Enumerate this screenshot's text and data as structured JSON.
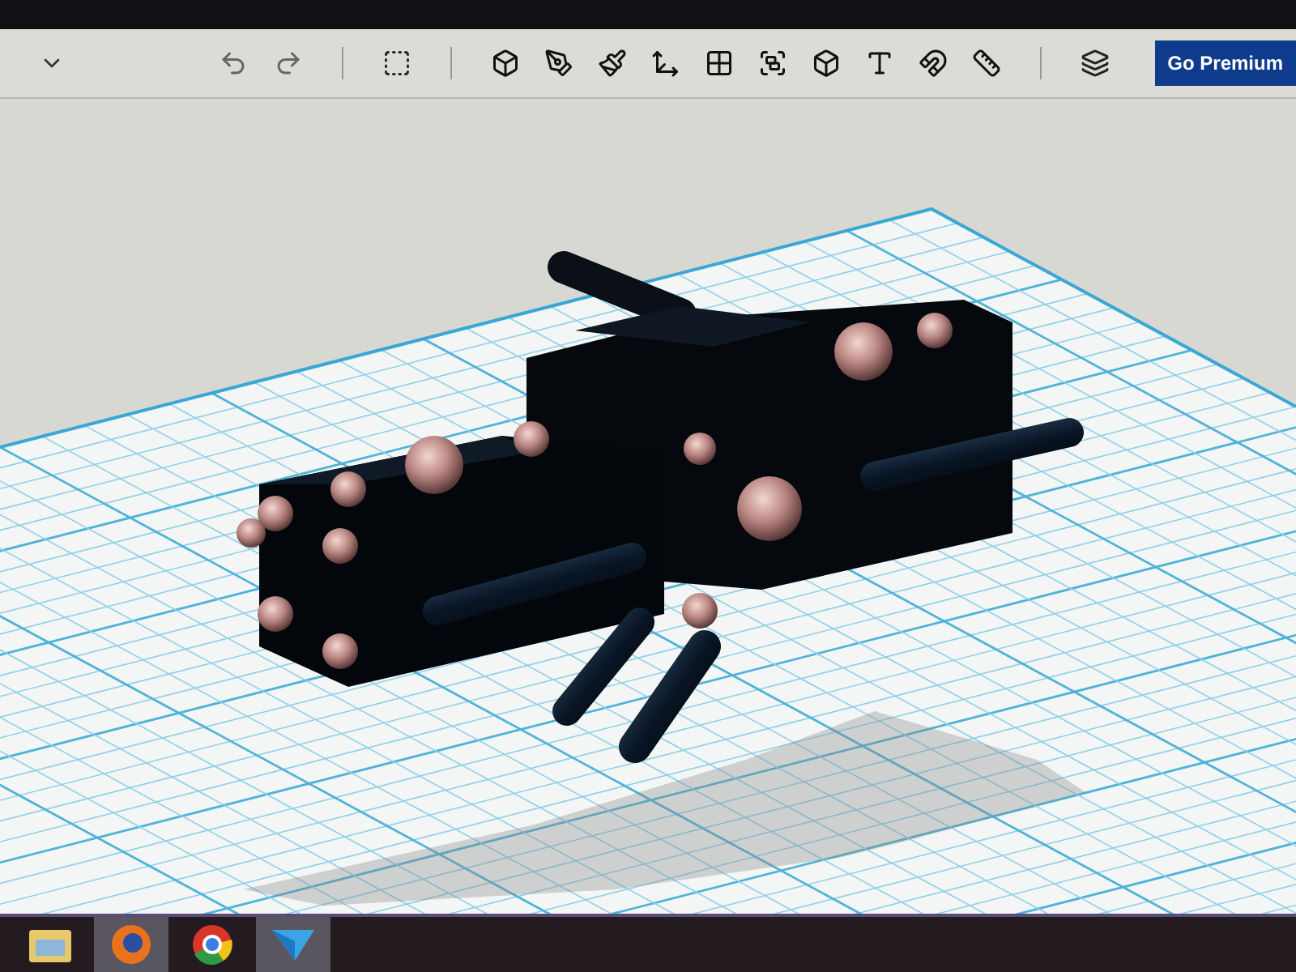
{
  "toolbar": {
    "premium_button": "Go Premium"
  },
  "taskbar": [
    {
      "kind": "folder",
      "selected": false
    },
    {
      "kind": "firefox",
      "selected": true
    },
    {
      "kind": "chrome",
      "selected": false
    },
    {
      "kind": "app",
      "selected": true
    }
  ]
}
